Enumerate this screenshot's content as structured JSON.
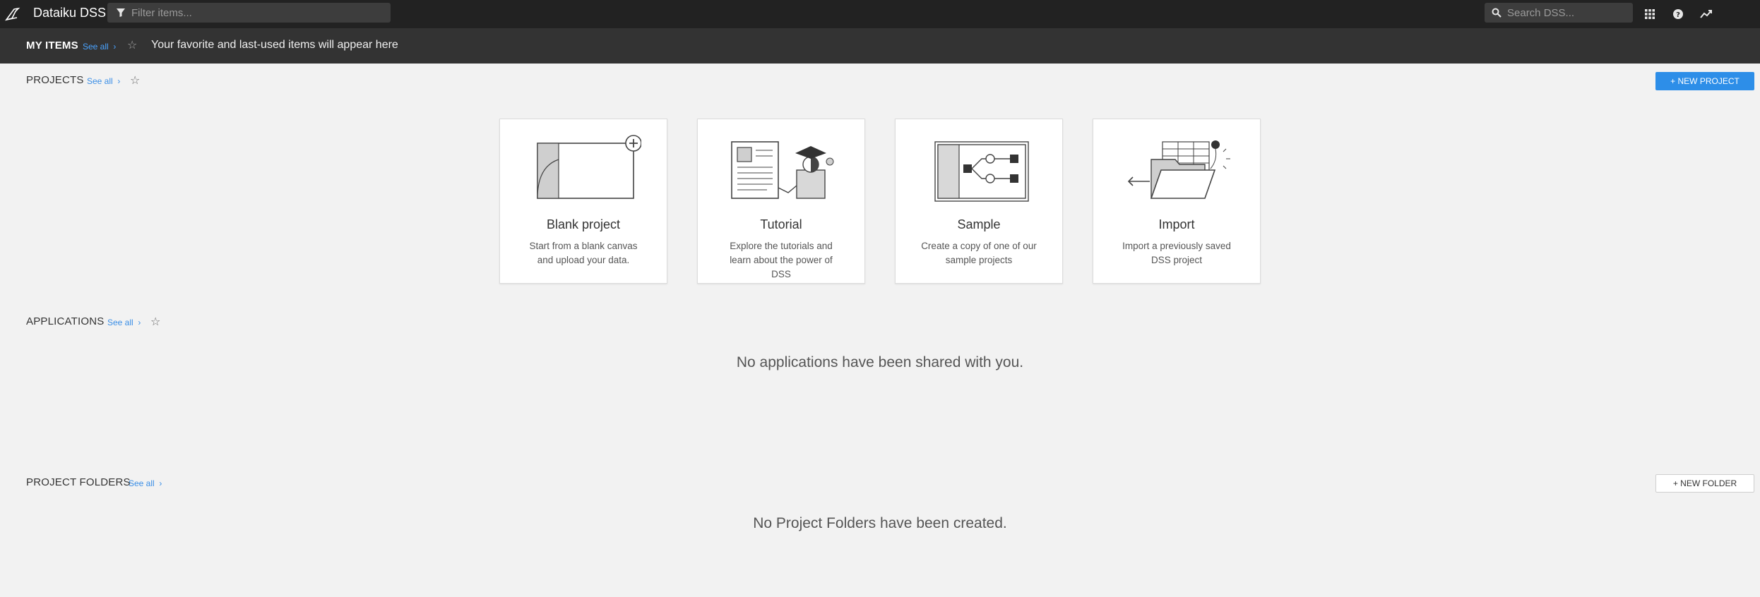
{
  "app": {
    "title": "Dataiku DSS"
  },
  "topbar": {
    "filter_placeholder": "Filter items...",
    "search_placeholder": "Search DSS..."
  },
  "my_items": {
    "title": "MY ITEMS",
    "see_all": "See all",
    "message": "Your favorite and last-used items will appear here"
  },
  "projects": {
    "title": "PROJECTS",
    "see_all": "See all",
    "new_button": "+ NEW PROJECT",
    "cards": [
      {
        "title": "Blank project",
        "desc": "Start from a blank canvas and upload your data."
      },
      {
        "title": "Tutorial",
        "desc": "Explore the tutorials and learn about the power of DSS"
      },
      {
        "title": "Sample",
        "desc": "Create a copy of one of our sample projects"
      },
      {
        "title": "Import",
        "desc": "Import a previously saved DSS project"
      }
    ]
  },
  "applications": {
    "title": "APPLICATIONS",
    "see_all": "See all",
    "empty": "No applications have been shared with you."
  },
  "project_folders": {
    "title": "PROJECT FOLDERS",
    "see_all": "See all",
    "new_button": "+ NEW FOLDER",
    "empty": "No Project Folders have been created."
  },
  "colors": {
    "topbar_bg": "#222222",
    "myitems_bg": "#333333",
    "accent": "#2d8ee8",
    "page_bg": "#f2f2f2"
  }
}
